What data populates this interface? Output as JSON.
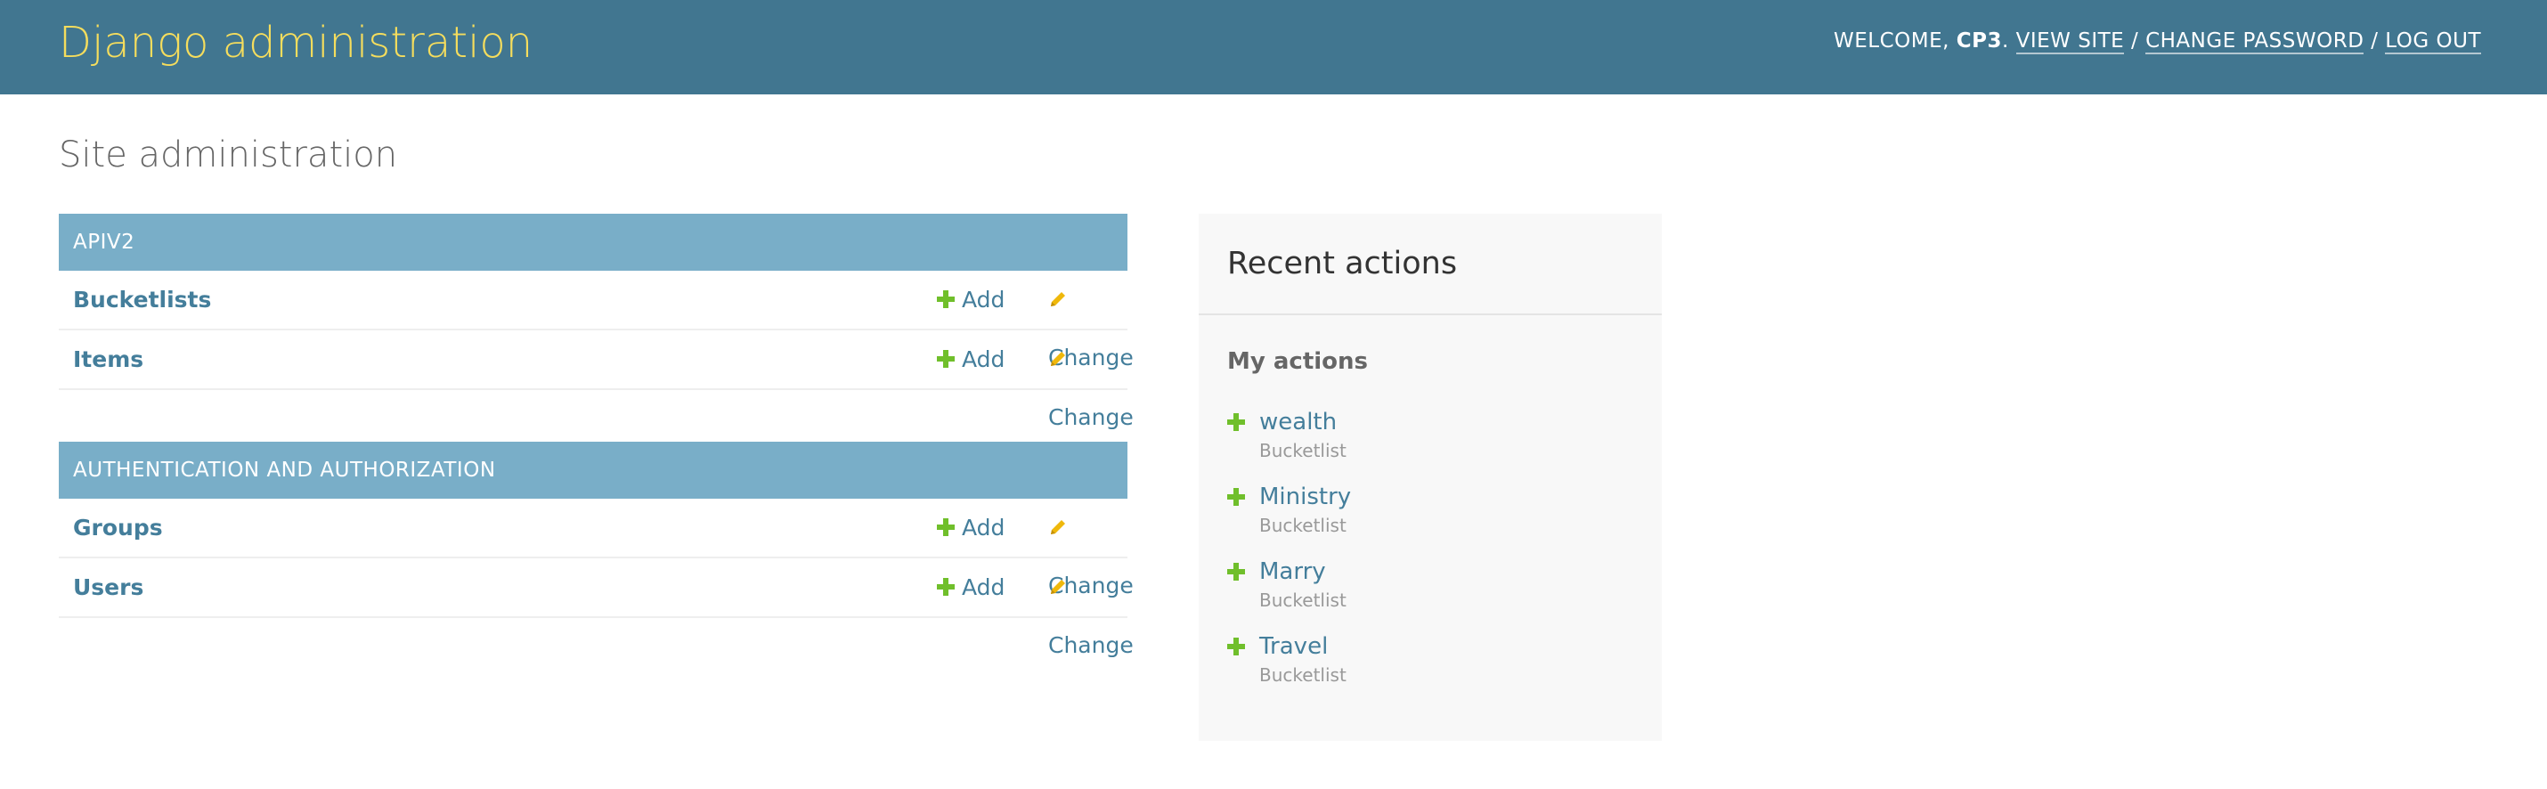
{
  "header": {
    "branding": "Django administration",
    "welcome": "WELCOME,",
    "username": "CP3",
    "separator_period": ".",
    "view_site": "VIEW SITE",
    "change_password": "CHANGE PASSWORD",
    "log_out": "LOG OUT",
    "slash": "/"
  },
  "page": {
    "title": "Site administration"
  },
  "apps": [
    {
      "caption": "APIV2",
      "models": [
        {
          "name": "Bucketlists",
          "add": "Add",
          "change": "Change"
        },
        {
          "name": "Items",
          "add": "Add",
          "change": "Change"
        }
      ]
    },
    {
      "caption": "AUTHENTICATION AND AUTHORIZATION",
      "models": [
        {
          "name": "Groups",
          "add": "Add",
          "change": "Change"
        },
        {
          "name": "Users",
          "add": "Add",
          "change": "Change"
        }
      ]
    }
  ],
  "recent_actions": {
    "title": "Recent actions",
    "subtitle": "My actions",
    "items": [
      {
        "name": "wealth",
        "type": "Bucketlist",
        "icon": "plus-icon"
      },
      {
        "name": "Ministry",
        "type": "Bucketlist",
        "icon": "plus-icon"
      },
      {
        "name": "Marry",
        "type": "Bucketlist",
        "icon": "plus-icon"
      },
      {
        "name": "Travel",
        "type": "Bucketlist",
        "icon": "plus-icon"
      }
    ]
  },
  "colors": {
    "header_bg": "#417690",
    "branding": "#f5dd5d",
    "caption_bg": "#79aec8",
    "link": "#447e9b",
    "add_icon": "#70bf2b",
    "change_icon": "#efb80b",
    "sidebar_bg": "#f8f8f8"
  }
}
